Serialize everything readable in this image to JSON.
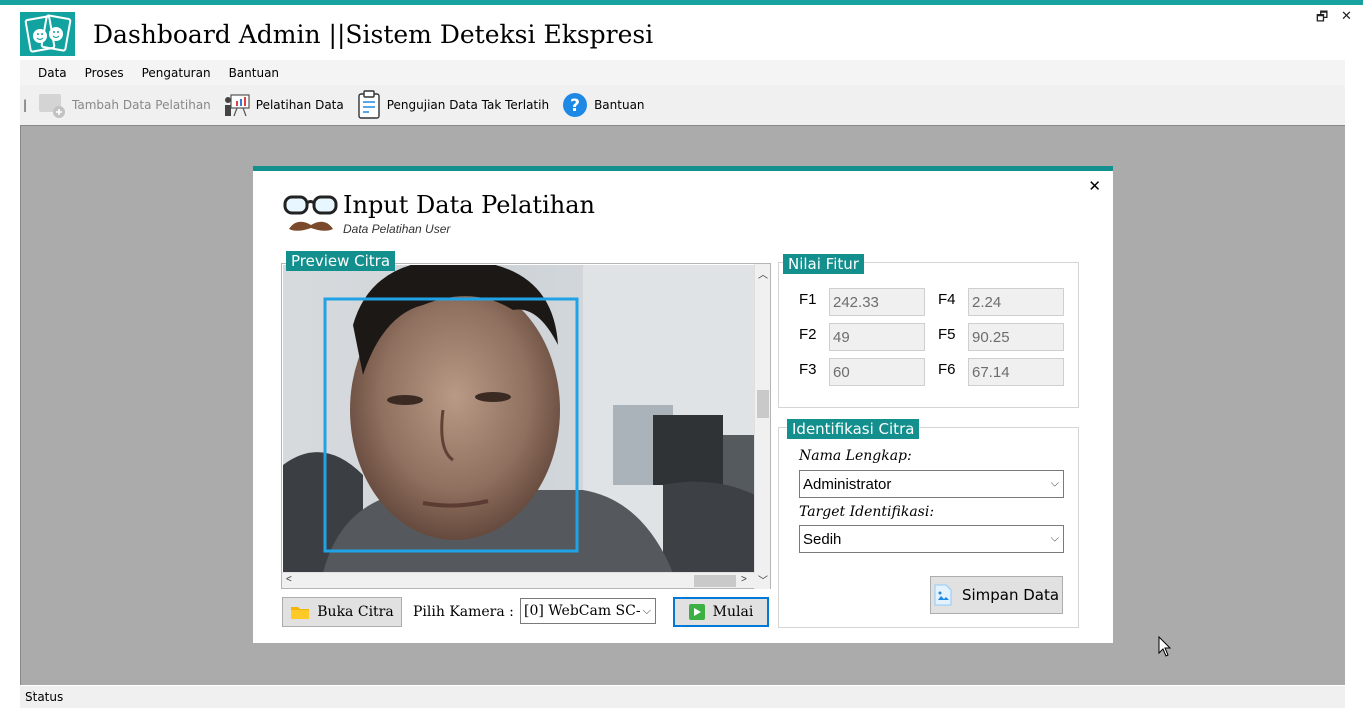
{
  "app": {
    "title": "Dashboard Admin ||Sistem Deteksi Ekspresi",
    "accent": "#17a2a0"
  },
  "window_controls": {
    "restore": "🗗",
    "close": "✕"
  },
  "menu": [
    "Data",
    "Proses",
    "Pengaturan",
    "Bantuan"
  ],
  "toolbar": {
    "separator": "|",
    "items": [
      {
        "label": "Tambah Data Pelatihan",
        "icon": "add-image-icon",
        "enabled": false
      },
      {
        "label": "Pelatihan Data",
        "icon": "presentation-icon",
        "enabled": true
      },
      {
        "label": "Pengujian Data Tak Terlatih",
        "icon": "clipboard-icon",
        "enabled": true
      },
      {
        "label": "Bantuan",
        "icon": "help-icon",
        "enabled": true
      }
    ]
  },
  "status": "Status",
  "dialog": {
    "close": "✕",
    "title": "Input Data Pelatihan",
    "subtitle": "Data Pelatihan User",
    "preview": {
      "label": "Preview Citra",
      "buka_citra": "Buka Citra",
      "pilih_kamera_label": "Pilih Kamera :",
      "camera_value": "[0] WebCam SC-",
      "mulai": "Mulai"
    },
    "fitur": {
      "label": "Nilai Fitur",
      "fields": [
        {
          "name": "F1",
          "value": "242.33"
        },
        {
          "name": "F2",
          "value": "49"
        },
        {
          "name": "F3",
          "value": "60"
        },
        {
          "name": "F4",
          "value": "2.24"
        },
        {
          "name": "F5",
          "value": "90.25"
        },
        {
          "name": "F6",
          "value": "67.14"
        }
      ]
    },
    "identifikasi": {
      "label": "Identifikasi Citra",
      "nama_label": "Nama Lengkap:",
      "nama_value": "Administrator",
      "target_label": "Target Identifikasi:",
      "target_value": "Sedih",
      "simpan": "Simpan Data"
    }
  }
}
